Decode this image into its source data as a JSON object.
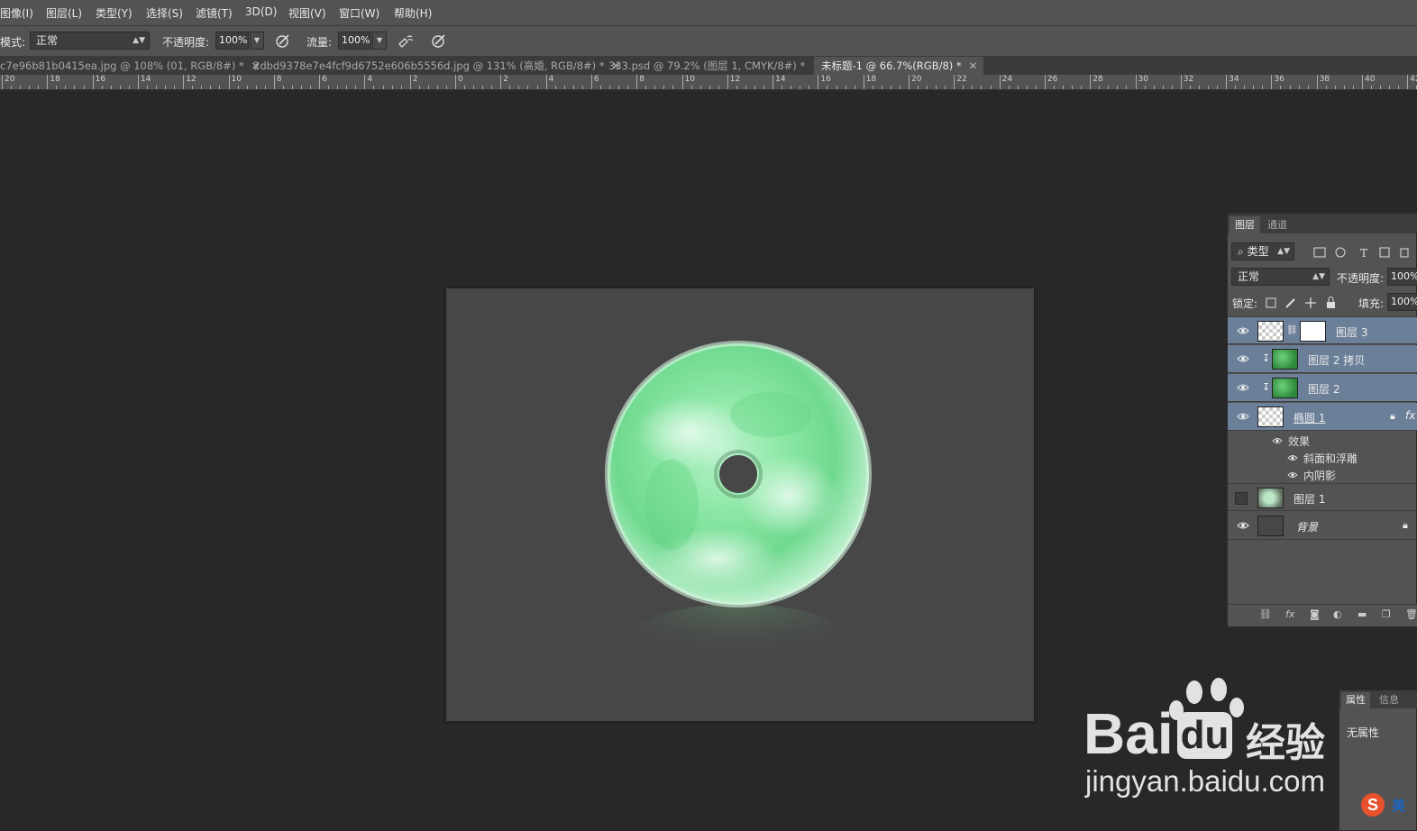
{
  "menu": [
    "图像(I)",
    "图层(L)",
    "类型(Y)",
    "选择(S)",
    "滤镜(T)",
    "3D(D)",
    "视图(V)",
    "窗口(W)",
    "帮助(H)"
  ],
  "options": {
    "mode_label": "模式:",
    "mode_value": "正常",
    "opacity_label": "不透明度:",
    "opacity_value": "100%",
    "flow_label": "流量:",
    "flow_value": "100%"
  },
  "tabs": [
    {
      "label": "c7e96b81b0415ea.jpg @ 108% (01, RGB/8#) *"
    },
    {
      "label": "2dbd9378e7e4fcf9d6752e606b5556d.jpg @ 131% (高婚, RGB/8#) *"
    },
    {
      "label": "333.psd @ 79.2% (图层 1, CMYK/8#) *"
    },
    {
      "label": "未标题-1 @ 66.7%(RGB/8) *"
    }
  ],
  "ruler": [
    "20",
    "18",
    "16",
    "14",
    "12",
    "10",
    "8",
    "6",
    "4",
    "2",
    "0",
    "2",
    "4",
    "6",
    "8",
    "10",
    "12",
    "14",
    "16",
    "18",
    "20",
    "22",
    "24",
    "26",
    "28",
    "30",
    "32",
    "34",
    "36",
    "38",
    "40",
    "42"
  ],
  "layers_panel": {
    "tab_layers": "图层",
    "tab_channels": "通道",
    "filter_kind": "类型",
    "blend_mode": "正常",
    "opacity_label": "不透明度:",
    "opacity_value": "100%",
    "lock_label": "锁定:",
    "fill_label": "填充:",
    "fill_value": "100%",
    "layers": [
      {
        "name": "图层 3"
      },
      {
        "name": "图层 2 拷贝"
      },
      {
        "name": "图层 2"
      },
      {
        "name": "椭圆 1"
      },
      {
        "name": "效果"
      },
      {
        "name": "斜面和浮雕"
      },
      {
        "name": "内阴影"
      },
      {
        "name": "图层 1"
      },
      {
        "name": "背景"
      }
    ]
  },
  "properties_panel": {
    "tab_properties": "属性",
    "tab_info": "信息",
    "content": "无属性"
  },
  "watermark": {
    "brand": "Bai",
    "brand2": "du",
    "suffix": "经验",
    "url": "jingyan.baidu.com"
  },
  "ime": {
    "label": "英"
  }
}
